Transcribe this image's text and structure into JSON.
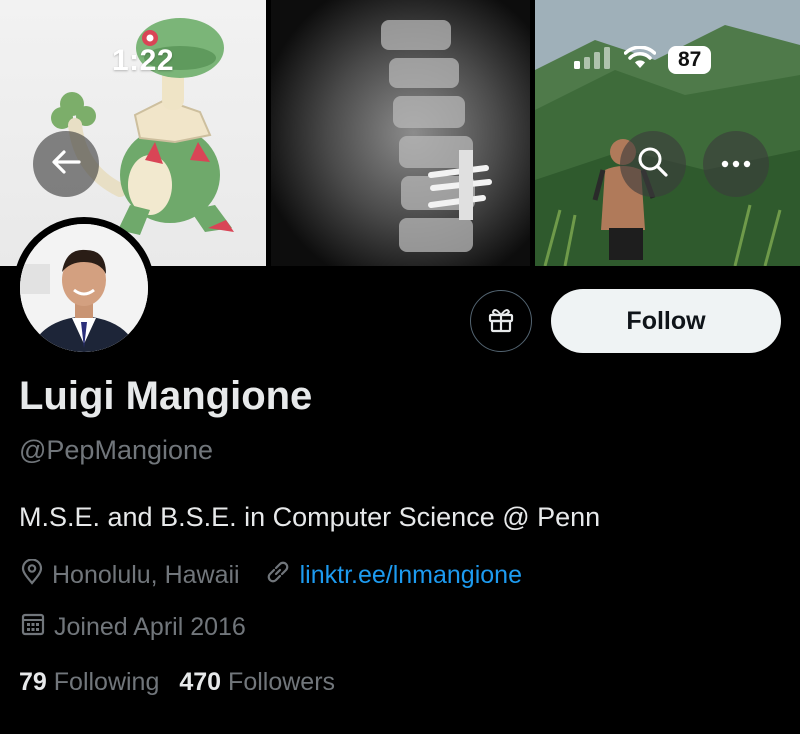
{
  "status_bar": {
    "time": "1:22",
    "battery": "87",
    "icons": [
      "cellular-signal-icon",
      "wifi-icon",
      "battery-icon"
    ]
  },
  "banner": {
    "panels": [
      "cartoon-creature-illustration",
      "spine-xray-image",
      "hiker-on-mountain-photo"
    ],
    "buttons": {
      "back": "arrow-left-icon",
      "search": "search-icon",
      "more": "more-dots-icon"
    }
  },
  "profile": {
    "avatar": "profile-photo",
    "display_name": "Luigi Mangione",
    "handle": "@PepMangione",
    "bio": "M.S.E. and B.S.E. in Computer Science @ Penn",
    "location": "Honolulu, Hawaii",
    "link": "linktr.ee/lnmangione",
    "joined": "Joined April 2016",
    "following_count": "79",
    "following_label": "Following",
    "followers_count": "470",
    "followers_label": "Followers"
  },
  "actions": {
    "gift_icon": "gift-icon",
    "follow_label": "Follow"
  },
  "colors": {
    "background": "#000000",
    "primary_text": "#e7e9ea",
    "secondary_text": "#71767b",
    "link": "#1d9bf0",
    "follow_button_bg": "#eff3f4"
  }
}
